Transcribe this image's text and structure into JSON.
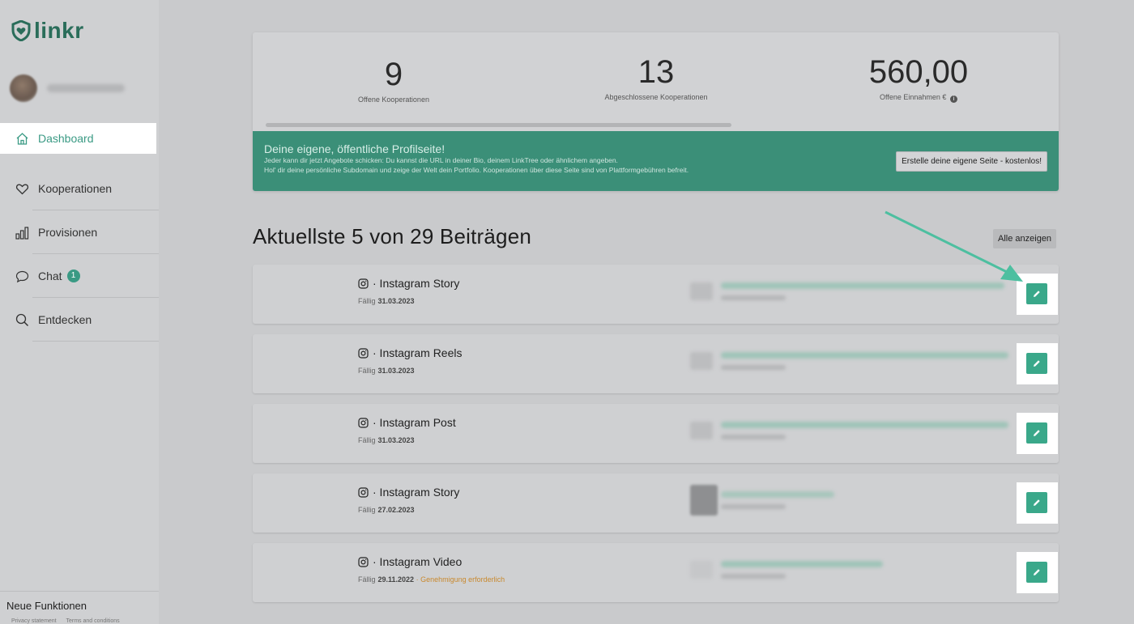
{
  "app": {
    "logo_text": "linkr",
    "brand_color": "#2a6d5a",
    "accent_color": "#3aa88a"
  },
  "sidebar": {
    "items": [
      {
        "label": "Dashboard",
        "icon": "home-icon",
        "active": true
      },
      {
        "label": "Kooperationen",
        "icon": "heart-icon"
      },
      {
        "label": "Provisionen",
        "icon": "bar-chart-icon"
      },
      {
        "label": "Chat",
        "icon": "chat-bubble-icon",
        "badge": "1"
      },
      {
        "label": "Entdecken",
        "icon": "search-icon"
      }
    ],
    "new_features": "Neue Funktionen",
    "legal": [
      "Privacy statement",
      "Terms and conditions"
    ]
  },
  "stats": {
    "open_cooperations": {
      "value": "9",
      "label": "Offene Kooperationen"
    },
    "closed_cooperations": {
      "value": "13",
      "label": "Abgeschlossene Kooperationen"
    },
    "open_income": {
      "value": "560,00",
      "label": "Offene Einnahmen €"
    }
  },
  "banner": {
    "title": "Deine eigene, öffentliche Profilseite!",
    "line1": "Jeder kann dir jetzt Angebote schicken: Du kannst die URL in deiner Bio, deinem LinkTree oder ähnlichem angeben.",
    "line2": "Hol' dir deine persönliche Subdomain und zeige der Welt dein Portfolio. Kooperationen über diese Seite sind von Plattformgebühren befreit.",
    "button": "Erstelle deine eigene Seite - kostenlos!"
  },
  "posts_section": {
    "title": "Aktuellste 5 von 29 Beiträgen",
    "show_all": "Alle anzeigen",
    "due_label": "Fällig",
    "posts": [
      {
        "type": "· Instagram Story",
        "due": "31.03.2023",
        "status": ""
      },
      {
        "type": "· Instagram Reels",
        "due": "31.03.2023",
        "status": ""
      },
      {
        "type": "· Instagram Post",
        "due": "31.03.2023",
        "status": ""
      },
      {
        "type": "· Instagram Story",
        "due": "27.02.2023",
        "status": ""
      },
      {
        "type": "· Instagram Video",
        "due": "29.11.2022",
        "status": "· Genehmigung erforderlich"
      }
    ]
  }
}
